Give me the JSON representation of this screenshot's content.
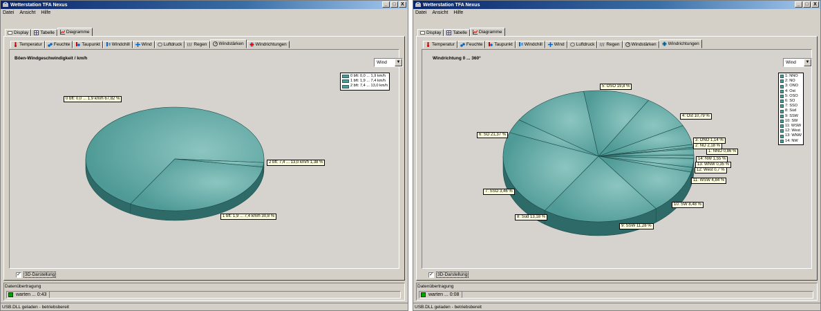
{
  "colors": {
    "pie_fill": "#4f9a96",
    "pie_side": "#2e6b68",
    "title_bar": "#0a246a",
    "status_green": "#00a000"
  },
  "windows": [
    {
      "title": "Wetterstation TFA Nexus",
      "title_buttons": [
        "_",
        "□",
        "X"
      ],
      "menu": [
        "Datei",
        "Ansicht",
        "Hilfe"
      ],
      "top_tabs": [
        {
          "label": "Display",
          "icon": "display-icon"
        },
        {
          "label": "Tabelle",
          "icon": "table-icon"
        },
        {
          "label": "Diagramme",
          "icon": "chart-icon"
        }
      ],
      "sub_tabs": [
        {
          "label": "Temperatur",
          "icon": "thermometer-icon"
        },
        {
          "label": "Feuchte",
          "icon": "humidity-icon"
        },
        {
          "label": "Taupunkt",
          "icon": "dewpoint-icon"
        },
        {
          "label": "Windchill",
          "icon": "windchill-icon"
        },
        {
          "label": "Wind",
          "icon": "wind-icon"
        },
        {
          "label": "Luftdruck",
          "icon": "pressure-icon"
        },
        {
          "label": "Regen",
          "icon": "rain-icon"
        },
        {
          "label": "Windstärken",
          "icon": "windforce-icon"
        },
        {
          "label": "Windrichtungen",
          "icon": "winddirection-icon"
        }
      ],
      "selected_sub_tab": "Windstärken",
      "selector_value": "Wind",
      "checkbox_3d": {
        "label": "3D-Darstellung",
        "checked": true
      },
      "transfer": {
        "group_label": "Datenübertragung",
        "status": "warten ... 0:43"
      },
      "statusbar": "USB.DLL geladen - betriebsbereit"
    },
    {
      "title": "Wetterstation TFA Nexus",
      "title_buttons": [
        "_",
        "□",
        "X"
      ],
      "menu": [
        "Datei",
        "Ansicht",
        "Hilfe"
      ],
      "top_tabs": [
        {
          "label": "Display",
          "icon": "display-icon"
        },
        {
          "label": "Tabelle",
          "icon": "table-icon"
        },
        {
          "label": "Diagramme",
          "icon": "chart-icon"
        }
      ],
      "sub_tabs": [
        {
          "label": "Temperatur",
          "icon": "thermometer-icon"
        },
        {
          "label": "Feuchte",
          "icon": "humidity-icon"
        },
        {
          "label": "Taupunkt",
          "icon": "dewpoint-icon"
        },
        {
          "label": "Windchill",
          "icon": "windchill-icon"
        },
        {
          "label": "Wind",
          "icon": "wind-icon"
        },
        {
          "label": "Luftdruck",
          "icon": "pressure-icon"
        },
        {
          "label": "Regen",
          "icon": "rain-icon"
        },
        {
          "label": "Windstärken",
          "icon": "windforce-icon"
        },
        {
          "label": "Windrichtungen",
          "icon": "winddirection-icon"
        }
      ],
      "selected_sub_tab": "Windrichtungen",
      "selector_value": "Wind",
      "checkbox_3d": {
        "label": "3D-Darstellung",
        "checked": true
      },
      "transfer": {
        "group_label": "Datenübertragung",
        "status": "warten ... 0:08"
      },
      "statusbar": "USB.DLL geladen - betriebsbereit"
    }
  ],
  "chart_data": [
    {
      "type": "pie",
      "title": "Böen-Windgeschwindigkeit / km/h",
      "three_d": true,
      "legend_position": "top-right",
      "legend": [
        "0 bft: 0,0 ... 1,9 km/h",
        "1 bft: 1,9 ... 7,4 km/h",
        "2 bft: 7,4 ... 13,0 km/h"
      ],
      "slices": [
        {
          "name": "0 bft: 0,0 ... 1,9 km/h",
          "value": 67.82,
          "label": "0 bft: 0,0 ... 1,9 km/h 67,82 %"
        },
        {
          "name": "1 bft: 1,9 ... 7,4 km/h",
          "value": 30.8,
          "label": "1 bft: 1,9 ... 7,4 km/h 30,8 %"
        },
        {
          "name": "2 bft: 7,4 ... 13,0 km/h",
          "value": 1.38,
          "label": "2 bft: 7,4 ... 13,0 km/h 1,38 %"
        }
      ]
    },
    {
      "type": "pie",
      "title": "Windrichtung 0 ... 360°",
      "three_d": true,
      "legend_position": "top-right",
      "legend": [
        "1: NNO",
        "2: NO",
        "3: ONO",
        "4: Ost",
        "5: OSO",
        "6: SO",
        "7: SSO",
        "8: Süd",
        "9: SSW",
        "10: SW",
        "11: WSW",
        "12: West",
        "13: WNW",
        "14: NW"
      ],
      "slices": [
        {
          "name": "1: NNO",
          "value": 0.86,
          "label": "1: NNO 0,86 %"
        },
        {
          "name": "2: NO",
          "value": 2.18,
          "label": "2: NO 2,18 %"
        },
        {
          "name": "3: ONO",
          "value": 1.14,
          "label": "3: ONO 1,14 %"
        },
        {
          "name": "4: Ost",
          "value": 10.79,
          "label": "4: Ost 10,79 %"
        },
        {
          "name": "5: OSO",
          "value": 19.8,
          "label": "5: OSO 19,8 %"
        },
        {
          "name": "6: SO",
          "value": 21.37,
          "label": "6: SO 21,37 %"
        },
        {
          "name": "7: SSO",
          "value": 3.46,
          "label": "7: SSO 3,46 %"
        },
        {
          "name": "8: Süd",
          "value": 13.18,
          "label": "8: Süd 13,18 %"
        },
        {
          "name": "9: SSW",
          "value": 11.28,
          "label": "9: SSW 11,28 %"
        },
        {
          "name": "10: SW",
          "value": 8.48,
          "label": "10: SW 8,48 %"
        },
        {
          "name": "11: WSW",
          "value": 4.84,
          "label": "11: WSW 4,84 %"
        },
        {
          "name": "12: West",
          "value": 0.7,
          "label": "12: West 0,7 %"
        },
        {
          "name": "13: WNW",
          "value": 0.35,
          "label": "13: WNW 0,35 %"
        },
        {
          "name": "14: NW",
          "value": 1.55,
          "label": "14: NW 1,55 %"
        }
      ]
    }
  ]
}
